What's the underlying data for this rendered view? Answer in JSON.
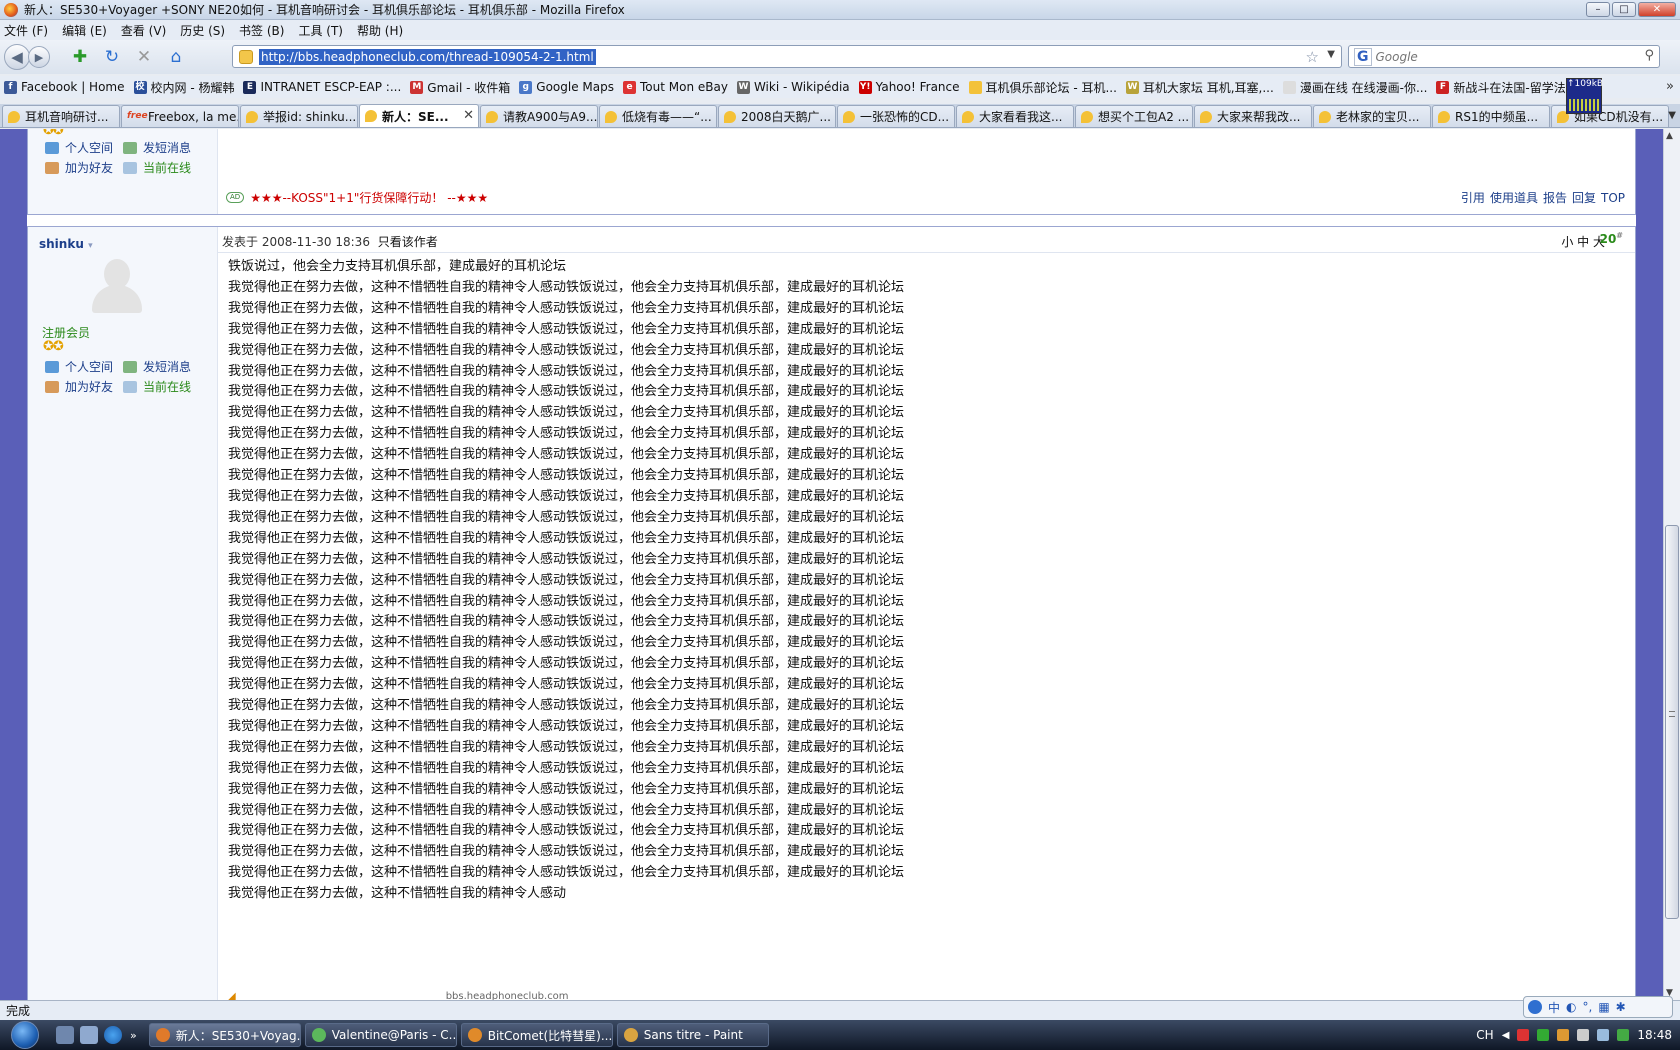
{
  "window": {
    "title": "新人：SE530+Voyager +SONY NE20如何 - 耳机音响研讨会 - 耳机俱乐部论坛 - 耳机俱乐部 - Mozilla Firefox",
    "minimize": "–",
    "maximize": "□",
    "close": "✕"
  },
  "menu": [
    "文件 (F)",
    "编辑 (E)",
    "查看 (V)",
    "历史 (S)",
    "书签 (B)",
    "工具 (T)",
    "帮助 (H)"
  ],
  "nav": {
    "url": "http://bbs.headphoneclub.com/thread-109054-2-1.html",
    "search_engine": "G",
    "search_placeholder": "Google"
  },
  "bookmarks": [
    {
      "label": "Facebook | Home",
      "icon": "facebook-icon",
      "color": "#3b5998",
      "glyph": "f"
    },
    {
      "label": "校内网 - 杨耀韩",
      "icon": "xiaonei-icon",
      "color": "#2a4f9a",
      "glyph": "校"
    },
    {
      "label": "INTRANET ESCP-EAP :...",
      "icon": "escp-icon",
      "color": "#1a2a5a",
      "glyph": "E"
    },
    {
      "label": "Gmail - 收件箱",
      "icon": "gmail-icon",
      "color": "#c33",
      "glyph": "M"
    },
    {
      "label": "Google Maps",
      "icon": "google-maps-icon",
      "color": "#4a78c8",
      "glyph": "g"
    },
    {
      "label": "Tout Mon eBay",
      "icon": "ebay-icon",
      "color": "#d33",
      "glyph": "e"
    },
    {
      "label": "Wiki - Wikipédia",
      "icon": "wikipedia-icon",
      "color": "#666",
      "glyph": "W"
    },
    {
      "label": "Yahoo! France",
      "icon": "yahoo-icon",
      "color": "#c00",
      "glyph": "Y!"
    },
    {
      "label": "耳机俱乐部论坛 - 耳机...",
      "icon": "headphoneclub-icon",
      "color": "#f3c23a",
      "glyph": ""
    },
    {
      "label": "耳机大家坛 耳机,耳塞,...",
      "icon": "erji-icon",
      "color": "#b8a33a",
      "glyph": "W"
    },
    {
      "label": "漫画在线 在线漫画-你...",
      "icon": "page-icon",
      "color": "#ddd",
      "glyph": ""
    },
    {
      "label": "新战斗在法国-留学法...",
      "icon": "xzd-icon",
      "color": "#c22",
      "glyph": "F"
    }
  ],
  "netmeter": "↑109kB",
  "tabs": [
    {
      "label": "耳机音响研讨...",
      "active": false,
      "fav": ""
    },
    {
      "label": "Freebox, la me...",
      "active": false,
      "fav": "free"
    },
    {
      "label": "举报id: shinku...",
      "active": false,
      "fav": ""
    },
    {
      "label": "新人：SE...",
      "active": true,
      "fav": ""
    },
    {
      "label": "请教A900与A9...",
      "active": false,
      "fav": ""
    },
    {
      "label": "低烧有毒——“...",
      "active": false,
      "fav": ""
    },
    {
      "label": "2008白天鹅广...",
      "active": false,
      "fav": ""
    },
    {
      "label": "一张恐怖的CD...",
      "active": false,
      "fav": ""
    },
    {
      "label": "大家看看我这...",
      "active": false,
      "fav": ""
    },
    {
      "label": "想买个工包A2 ...",
      "active": false,
      "fav": ""
    },
    {
      "label": "大家来帮我改...",
      "active": false,
      "fav": ""
    },
    {
      "label": "老林家的宝贝...",
      "active": false,
      "fav": ""
    },
    {
      "label": "RS1的中频虽...",
      "active": false,
      "fav": ""
    },
    {
      "label": "如果CD机没有...",
      "active": false,
      "fav": ""
    }
  ],
  "prev_post": {
    "stars": "✪✪",
    "actions_row1": [
      "个人空间",
      "发短消息"
    ],
    "actions_row2": [
      "加为好友",
      "当前在线"
    ],
    "ad_badge": "AD",
    "ad_text": "★★★--KOSS\"1+1\"行货保障行动！ --★★★",
    "post_actions": [
      "引用",
      "使用道具",
      "报告",
      "回复",
      "TOP"
    ]
  },
  "post": {
    "username": "shinku",
    "dropdown": "▾",
    "rank": "注册会员",
    "stars": "✪✪",
    "actions_row1": [
      "个人空间",
      "发短消息"
    ],
    "actions_row2": [
      "加为好友",
      "当前在线"
    ],
    "posted_at": "发表于 2008-11-30 18:36",
    "only_author": "只看该作者",
    "font_sizes": "小 中 大",
    "floor": "20",
    "floor_sup": "#",
    "first_line": "铁饭说过，他会全力支持耳机俱乐部，建成最好的耳机论坛",
    "repeated_line": "我觉得他正在努力去做，这种不惜牺牲自我的精神令人感动铁饭说过，他会全力支持耳机俱乐部，建成最好的耳机论坛",
    "repeat_count": 29,
    "last_line": "我觉得他正在努力去做，这种不惜牺牲自我的精神令人感动",
    "footer_partial": "bbs.headphoneclub.com"
  },
  "status": "完成",
  "ime": {
    "label": "CH"
  },
  "taskbar": {
    "buttons": [
      {
        "label": "新人：SE530+Voyag...",
        "active": true,
        "color": "#e07a2a"
      },
      {
        "label": "Valentine@Paris - C...",
        "active": false,
        "color": "#5cb85c"
      },
      {
        "label": "BitComet(比特彗星)...",
        "active": false,
        "color": "#e08a2a"
      },
      {
        "label": "Sans titre - Paint",
        "active": false,
        "color": "#d9a441"
      }
    ],
    "lang": "CH",
    "clock": "18:48"
  }
}
